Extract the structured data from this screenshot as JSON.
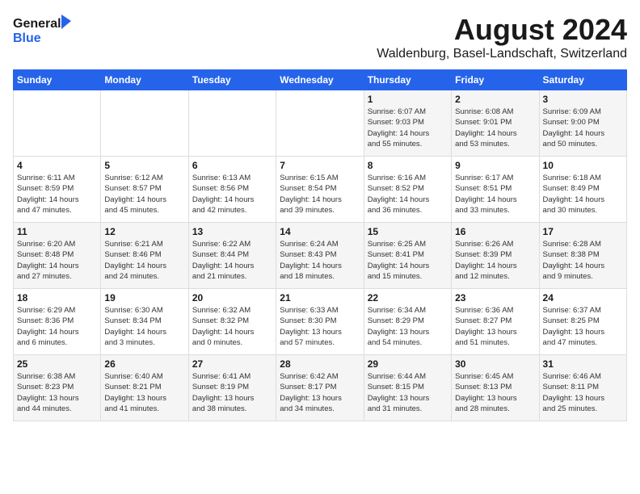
{
  "header": {
    "logo_line1": "General",
    "logo_line2": "Blue",
    "month_year": "August 2024",
    "location": "Waldenburg, Basel-Landschaft, Switzerland"
  },
  "weekdays": [
    "Sunday",
    "Monday",
    "Tuesday",
    "Wednesday",
    "Thursday",
    "Friday",
    "Saturday"
  ],
  "weeks": [
    [
      {
        "day": "",
        "data": ""
      },
      {
        "day": "",
        "data": ""
      },
      {
        "day": "",
        "data": ""
      },
      {
        "day": "",
        "data": ""
      },
      {
        "day": "1",
        "data": "Sunrise: 6:07 AM\nSunset: 9:03 PM\nDaylight: 14 hours\nand 55 minutes."
      },
      {
        "day": "2",
        "data": "Sunrise: 6:08 AM\nSunset: 9:01 PM\nDaylight: 14 hours\nand 53 minutes."
      },
      {
        "day": "3",
        "data": "Sunrise: 6:09 AM\nSunset: 9:00 PM\nDaylight: 14 hours\nand 50 minutes."
      }
    ],
    [
      {
        "day": "4",
        "data": "Sunrise: 6:11 AM\nSunset: 8:59 PM\nDaylight: 14 hours\nand 47 minutes."
      },
      {
        "day": "5",
        "data": "Sunrise: 6:12 AM\nSunset: 8:57 PM\nDaylight: 14 hours\nand 45 minutes."
      },
      {
        "day": "6",
        "data": "Sunrise: 6:13 AM\nSunset: 8:56 PM\nDaylight: 14 hours\nand 42 minutes."
      },
      {
        "day": "7",
        "data": "Sunrise: 6:15 AM\nSunset: 8:54 PM\nDaylight: 14 hours\nand 39 minutes."
      },
      {
        "day": "8",
        "data": "Sunrise: 6:16 AM\nSunset: 8:52 PM\nDaylight: 14 hours\nand 36 minutes."
      },
      {
        "day": "9",
        "data": "Sunrise: 6:17 AM\nSunset: 8:51 PM\nDaylight: 14 hours\nand 33 minutes."
      },
      {
        "day": "10",
        "data": "Sunrise: 6:18 AM\nSunset: 8:49 PM\nDaylight: 14 hours\nand 30 minutes."
      }
    ],
    [
      {
        "day": "11",
        "data": "Sunrise: 6:20 AM\nSunset: 8:48 PM\nDaylight: 14 hours\nand 27 minutes."
      },
      {
        "day": "12",
        "data": "Sunrise: 6:21 AM\nSunset: 8:46 PM\nDaylight: 14 hours\nand 24 minutes."
      },
      {
        "day": "13",
        "data": "Sunrise: 6:22 AM\nSunset: 8:44 PM\nDaylight: 14 hours\nand 21 minutes."
      },
      {
        "day": "14",
        "data": "Sunrise: 6:24 AM\nSunset: 8:43 PM\nDaylight: 14 hours\nand 18 minutes."
      },
      {
        "day": "15",
        "data": "Sunrise: 6:25 AM\nSunset: 8:41 PM\nDaylight: 14 hours\nand 15 minutes."
      },
      {
        "day": "16",
        "data": "Sunrise: 6:26 AM\nSunset: 8:39 PM\nDaylight: 14 hours\nand 12 minutes."
      },
      {
        "day": "17",
        "data": "Sunrise: 6:28 AM\nSunset: 8:38 PM\nDaylight: 14 hours\nand 9 minutes."
      }
    ],
    [
      {
        "day": "18",
        "data": "Sunrise: 6:29 AM\nSunset: 8:36 PM\nDaylight: 14 hours\nand 6 minutes."
      },
      {
        "day": "19",
        "data": "Sunrise: 6:30 AM\nSunset: 8:34 PM\nDaylight: 14 hours\nand 3 minutes."
      },
      {
        "day": "20",
        "data": "Sunrise: 6:32 AM\nSunset: 8:32 PM\nDaylight: 14 hours\nand 0 minutes."
      },
      {
        "day": "21",
        "data": "Sunrise: 6:33 AM\nSunset: 8:30 PM\nDaylight: 13 hours\nand 57 minutes."
      },
      {
        "day": "22",
        "data": "Sunrise: 6:34 AM\nSunset: 8:29 PM\nDaylight: 13 hours\nand 54 minutes."
      },
      {
        "day": "23",
        "data": "Sunrise: 6:36 AM\nSunset: 8:27 PM\nDaylight: 13 hours\nand 51 minutes."
      },
      {
        "day": "24",
        "data": "Sunrise: 6:37 AM\nSunset: 8:25 PM\nDaylight: 13 hours\nand 47 minutes."
      }
    ],
    [
      {
        "day": "25",
        "data": "Sunrise: 6:38 AM\nSunset: 8:23 PM\nDaylight: 13 hours\nand 44 minutes."
      },
      {
        "day": "26",
        "data": "Sunrise: 6:40 AM\nSunset: 8:21 PM\nDaylight: 13 hours\nand 41 minutes."
      },
      {
        "day": "27",
        "data": "Sunrise: 6:41 AM\nSunset: 8:19 PM\nDaylight: 13 hours\nand 38 minutes."
      },
      {
        "day": "28",
        "data": "Sunrise: 6:42 AM\nSunset: 8:17 PM\nDaylight: 13 hours\nand 34 minutes."
      },
      {
        "day": "29",
        "data": "Sunrise: 6:44 AM\nSunset: 8:15 PM\nDaylight: 13 hours\nand 31 minutes."
      },
      {
        "day": "30",
        "data": "Sunrise: 6:45 AM\nSunset: 8:13 PM\nDaylight: 13 hours\nand 28 minutes."
      },
      {
        "day": "31",
        "data": "Sunrise: 6:46 AM\nSunset: 8:11 PM\nDaylight: 13 hours\nand 25 minutes."
      }
    ]
  ]
}
